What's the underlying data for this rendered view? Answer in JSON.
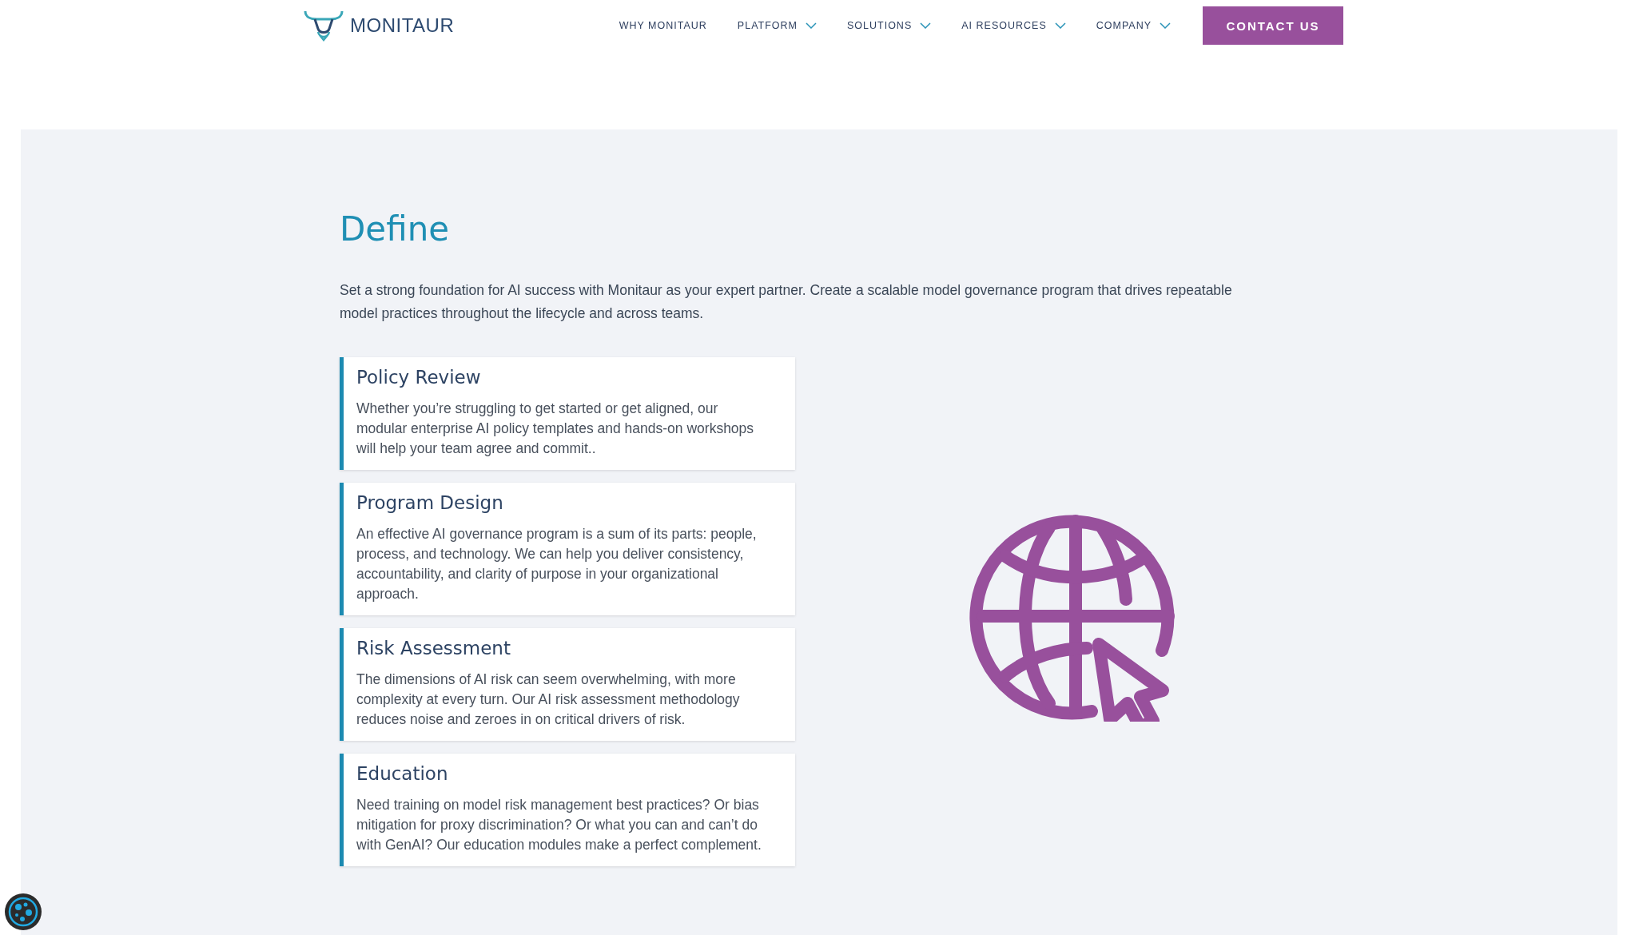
{
  "header": {
    "logo_text": "MONITAUR",
    "nav": [
      {
        "label": "WHY MONITAUR",
        "dropdown": false
      },
      {
        "label": "PLATFORM",
        "dropdown": true
      },
      {
        "label": "SOLUTIONS",
        "dropdown": true
      },
      {
        "label": "AI RESOURCES",
        "dropdown": true
      },
      {
        "label": "COMPANY",
        "dropdown": true
      }
    ],
    "cta": "CONTACT US"
  },
  "section": {
    "title": "Define",
    "intro": "Set a strong foundation for AI success with Monitaur as your expert partner. Create a scalable model governance program that drives repeatable model practices throughout the lifecycle and across teams.",
    "cards": [
      {
        "title": "Policy Review",
        "body": "Whether you’re struggling to get started or get aligned, our modular enterprise AI policy templates and hands-on workshops will help your team agree and commit.."
      },
      {
        "title": "Program Design",
        "body": "An effective AI governance program is a sum of its parts: people, process, and technology. We can help you deliver consistency, accountability, and clarity of purpose in your organizational approach."
      },
      {
        "title": "Risk Assessment",
        "body": "The dimensions of AI risk can seem overwhelming, with more complexity at every turn. Our AI risk assessment methodology reduces noise and zeroes in on critical drivers of risk."
      },
      {
        "title": "Education",
        "body": "Need training on model risk management best practices? Or bias mitigation for proxy discrimination? Or what you can and can’t do with GenAI? Our education modules make a perfect complement."
      }
    ]
  }
}
